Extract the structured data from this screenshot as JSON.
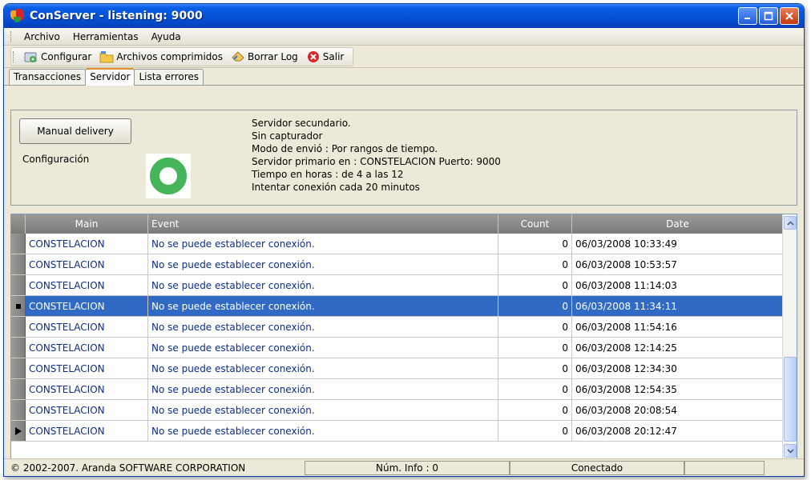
{
  "window": {
    "title": "ConServer - listening: 9000"
  },
  "menu": [
    "Archivo",
    "Herramientas",
    "Ayuda"
  ],
  "toolbar": {
    "configurar": "Configurar",
    "archivos": "Archivos comprimidos",
    "borrar": "Borrar Log",
    "salir": "Salir"
  },
  "tabs": [
    "Transacciones",
    "Servidor",
    "Lista errores"
  ],
  "panel": {
    "manual_delivery": "Manual delivery",
    "config_label": "Configuración",
    "info": [
      "Servidor secundario.",
      "Sin capturador",
      "Modo de envió : Por rangos de tiempo.",
      "Servidor primario en : CONSTELACION Puerto: 9000",
      "Tiempo en horas : de 4 a las 12",
      "Intentar conexión cada 20 minutos"
    ]
  },
  "grid": {
    "columns": {
      "main": "Main",
      "event": "Event",
      "count": "Count",
      "date": "Date"
    },
    "rows": [
      {
        "main": "CONSTELACION",
        "event": "No se puede establecer conexión.",
        "count": "0",
        "date": "06/03/2008 10:33:49"
      },
      {
        "main": "CONSTELACION",
        "event": "No se puede establecer conexión.",
        "count": "0",
        "date": "06/03/2008 10:53:57"
      },
      {
        "main": "CONSTELACION",
        "event": "No se puede establecer conexión.",
        "count": "0",
        "date": "06/03/2008 11:14:03"
      },
      {
        "main": "CONSTELACION",
        "event": "No se puede establecer conexión.",
        "count": "0",
        "date": "06/03/2008 11:34:11"
      },
      {
        "main": "CONSTELACION",
        "event": "No se puede establecer conexión.",
        "count": "0",
        "date": "06/03/2008 11:54:16"
      },
      {
        "main": "CONSTELACION",
        "event": "No se puede establecer conexión.",
        "count": "0",
        "date": "06/03/2008 12:14:25"
      },
      {
        "main": "CONSTELACION",
        "event": "No se puede establecer conexión.",
        "count": "0",
        "date": "06/03/2008 12:34:30"
      },
      {
        "main": "CONSTELACION",
        "event": "No se puede establecer conexión.",
        "count": "0",
        "date": "06/03/2008 12:54:35"
      },
      {
        "main": "CONSTELACION",
        "event": "No se puede establecer conexión.",
        "count": "0",
        "date": "06/03/2008 20:08:54"
      },
      {
        "main": "CONSTELACION",
        "event": "No se puede establecer conexión.",
        "count": "0",
        "date": "06/03/2008 20:12:47"
      }
    ]
  },
  "status": {
    "copyright": "© 2002-2007. Aranda SOFTWARE CORPORATION",
    "info": "Núm. Info : 0",
    "connection": "Conectado"
  }
}
